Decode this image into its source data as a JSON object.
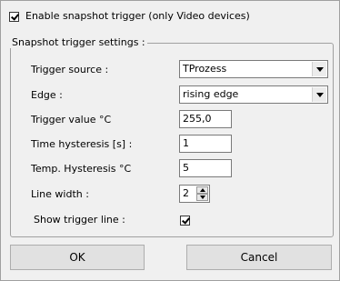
{
  "enable_snapshot": {
    "label": "Enable snapshot trigger (only Video devices)",
    "checked": true
  },
  "group": {
    "title": "Snapshot trigger settings :"
  },
  "fields": {
    "trigger_source": {
      "label": "Trigger source :",
      "value": "TProzess"
    },
    "edge": {
      "label": "Edge :",
      "value": "rising edge"
    },
    "trigger_value": {
      "label": "Trigger value °C",
      "value": "255,0"
    },
    "time_hysteresis": {
      "label": "Time hysteresis [s] :",
      "value": "1"
    },
    "temp_hysteresis": {
      "label": "Temp. Hysteresis °C",
      "value": "5"
    },
    "line_width": {
      "label": "Line width :",
      "value": "2"
    },
    "show_trigger_line": {
      "label": "Show trigger line :",
      "checked": true
    }
  },
  "buttons": {
    "ok": "OK",
    "cancel": "Cancel"
  },
  "icons": {
    "dropdown": "chevron-down-icon",
    "spin_up": "arrow-up-icon",
    "spin_down": "arrow-down-icon",
    "check": "checkmark-icon"
  }
}
